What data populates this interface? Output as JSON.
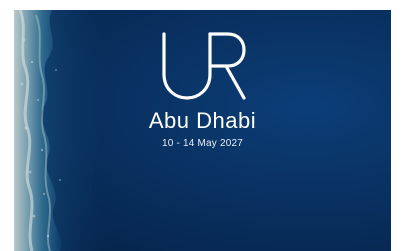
{
  "banner": {
    "logo_text": "UR",
    "city": "Abu Dhabi",
    "dates": "10 - 14 May 2027"
  },
  "colors": {
    "deep_ocean": "#072a55",
    "mid_ocean": "#0a3466",
    "shallow_reef": "#7fa6b8",
    "text": "#ffffff"
  },
  "icons": {
    "logo": "ur-logo-icon"
  }
}
